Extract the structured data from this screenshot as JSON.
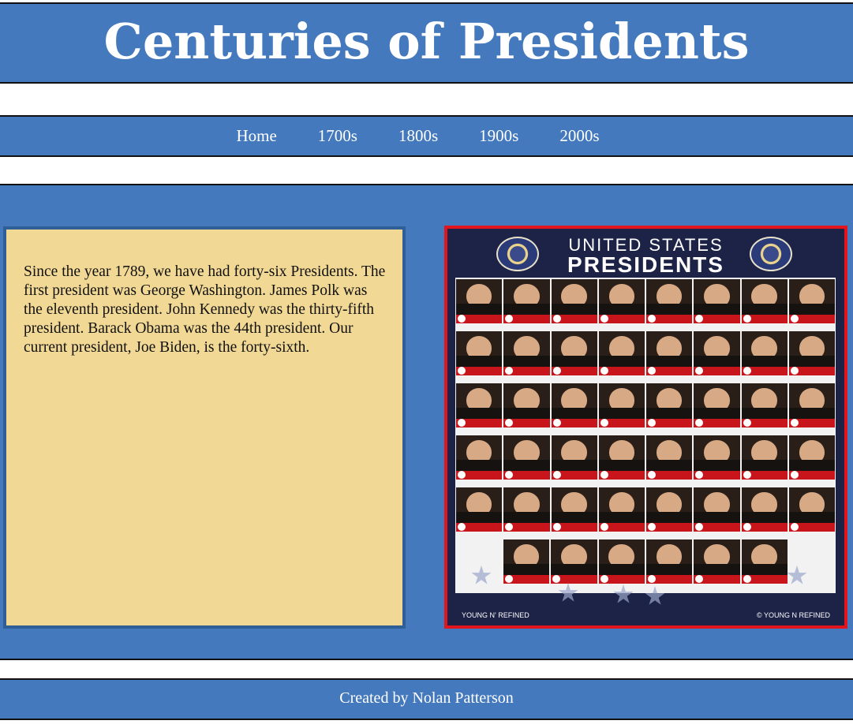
{
  "header": {
    "title": "Centuries of Presidents"
  },
  "nav": {
    "items": [
      "Home",
      "1700s",
      "1800s",
      "1900s",
      "2000s"
    ]
  },
  "main": {
    "text": "Since the year 1789, we have had forty-six Presidents. The first president was George Washington. James Polk was the eleventh president. John Kennedy was the thirty-fifth president. Barack Obama was the 44th president. Our current president, Joe Biden, is the forty-sixth.",
    "poster": {
      "title_line1": "UNITED STATES",
      "title_line2": "PRESIDENTS",
      "brand_left": "YOUNG N' REFINED",
      "brand_right": "© YOUNG N REFINED"
    }
  },
  "footer": {
    "credit": "Created by Nolan Patterson"
  }
}
